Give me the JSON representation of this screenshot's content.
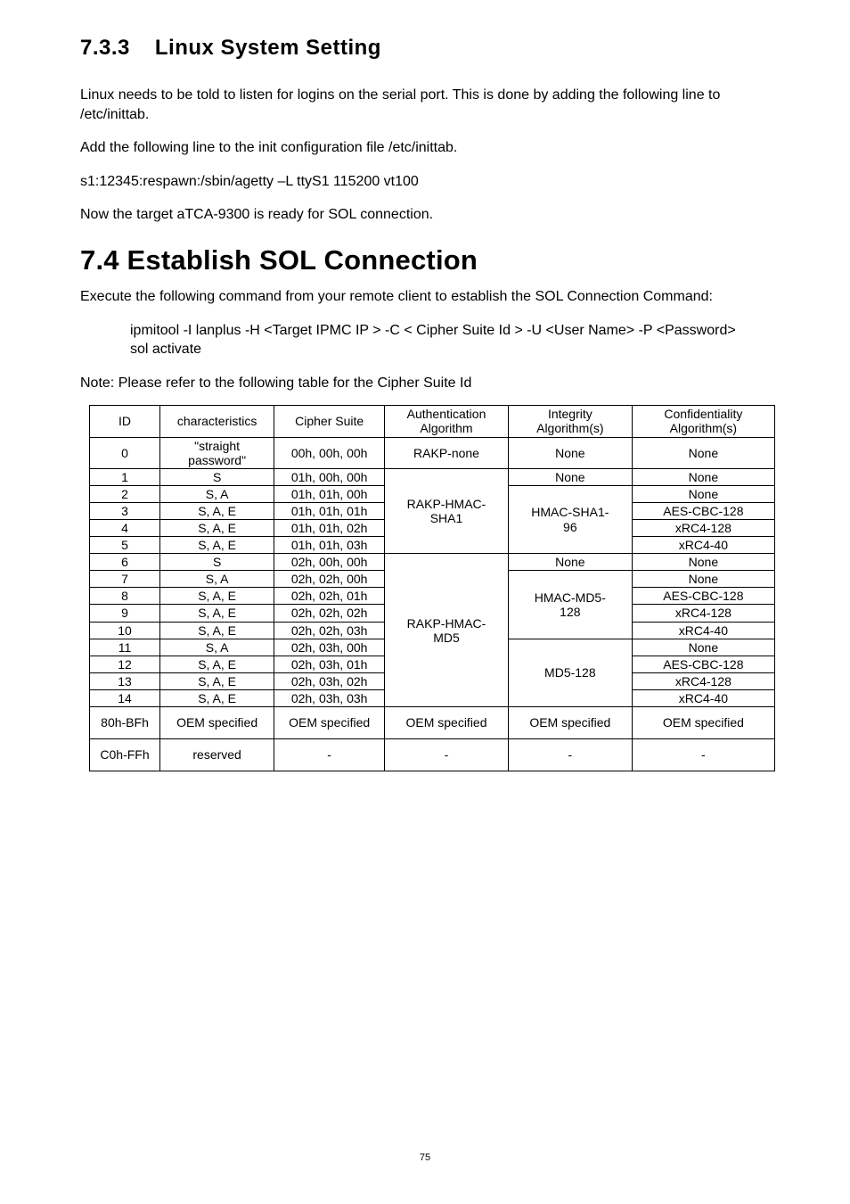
{
  "section_733": {
    "number": "7.3.3",
    "title": "Linux System Setting",
    "para1": "Linux needs to be told to listen for logins on the serial port. This is done by adding the following line to /etc/inittab.",
    "para2": "Add the following line to the init configuration file /etc/inittab.",
    "command": "s1:12345:respawn:/sbin/agetty –L ttyS1 115200 vt100",
    "para3": "Now the target aTCA-9300 is ready for SOL connection."
  },
  "section_74": {
    "number": "7.4",
    "title": "Establish SOL Connection",
    "para1": "Execute the following command from your remote client to establish the SOL Connection Command:",
    "command": "ipmitool -I lanplus -H <Target IPMC IP > -C < Cipher Suite Id > -U <User Name> -P <Password> sol activate",
    "note": "Note: Please refer to the following table for the Cipher Suite Id"
  },
  "table": {
    "headers": {
      "id": "ID",
      "characteristics": "characteristics",
      "cipher_suite": "Cipher Suite",
      "auth_line1": "Authentication",
      "auth_line2": "Algorithm",
      "integrity_line1": "Integrity",
      "integrity_line2": "Algorithm(s)",
      "conf_line1": "Confidentiality",
      "conf_line2": "Algorithm(s)"
    },
    "rows": {
      "r0": {
        "id": "0",
        "char_line1": "\"straight",
        "char_line2": "password\"",
        "cs": "00h, 00h, 00h",
        "auth": "RAKP-none",
        "integrity": "None",
        "conf": "None"
      },
      "r1": {
        "id": "1",
        "char": "S",
        "cs": "01h, 00h, 00h",
        "integrity": "None",
        "conf": "None"
      },
      "r2": {
        "id": "2",
        "char": "S, A",
        "cs": "01h, 01h, 00h",
        "conf": "None"
      },
      "r3": {
        "id": "3",
        "char": "S, A, E",
        "cs": "01h, 01h, 01h",
        "conf": "AES-CBC-128"
      },
      "r4": {
        "id": "4",
        "char": "S, A, E",
        "cs": "01h, 01h, 02h",
        "conf": "xRC4-128"
      },
      "r5": {
        "id": "5",
        "char": "S, A, E",
        "cs": "01h, 01h, 03h",
        "conf": "xRC4-40"
      },
      "r6": {
        "id": "6",
        "char": "S",
        "cs": "02h, 00h, 00h",
        "integrity": "None",
        "conf": "None"
      },
      "r7": {
        "id": "7",
        "char": "S, A",
        "cs": "02h, 02h, 00h",
        "conf": "None"
      },
      "r8": {
        "id": "8",
        "char": "S, A, E",
        "cs": "02h, 02h, 01h",
        "conf": "AES-CBC-128"
      },
      "r9": {
        "id": "9",
        "char": "S, A, E",
        "cs": "02h, 02h, 02h",
        "conf": "xRC4-128"
      },
      "r10": {
        "id": "10",
        "char": "S, A, E",
        "cs": "02h, 02h, 03h",
        "conf": "xRC4-40"
      },
      "r11": {
        "id": "11",
        "char": "S, A",
        "cs": "02h, 03h, 00h",
        "conf": "None"
      },
      "r12": {
        "id": "12",
        "char": "S, A, E",
        "cs": "02h, 03h, 01h",
        "conf": "AES-CBC-128"
      },
      "r13": {
        "id": "13",
        "char": "S, A, E",
        "cs": "02h, 03h, 02h",
        "conf": "xRC4-128"
      },
      "r14": {
        "id": "14",
        "char": "S, A, E",
        "cs": "02h, 03h, 03h",
        "conf": "xRC4-40"
      },
      "r15": {
        "id": "80h-BFh",
        "char": "OEM specified",
        "cs": "OEM specified",
        "auth": "OEM specified",
        "integrity": "OEM specified",
        "conf": "OEM specified"
      },
      "r16": {
        "id": "C0h-FFh",
        "char": "reserved",
        "cs": "-",
        "auth": "-",
        "integrity": "-",
        "conf": "-"
      }
    },
    "merged": {
      "auth_rakp_sha1_line1": "RAKP-HMAC-",
      "auth_rakp_sha1_line2": "SHA1",
      "auth_rakp_md5_line1": "RAKP-HMAC-",
      "auth_rakp_md5_line2": "MD5",
      "int_hmac_sha1_line1": "HMAC-SHA1-",
      "int_hmac_sha1_line2": "96",
      "int_hmac_md5_line1": "HMAC-MD5-",
      "int_hmac_md5_line2": "128",
      "int_md5_128": "MD5-128"
    }
  },
  "page_number": "75"
}
